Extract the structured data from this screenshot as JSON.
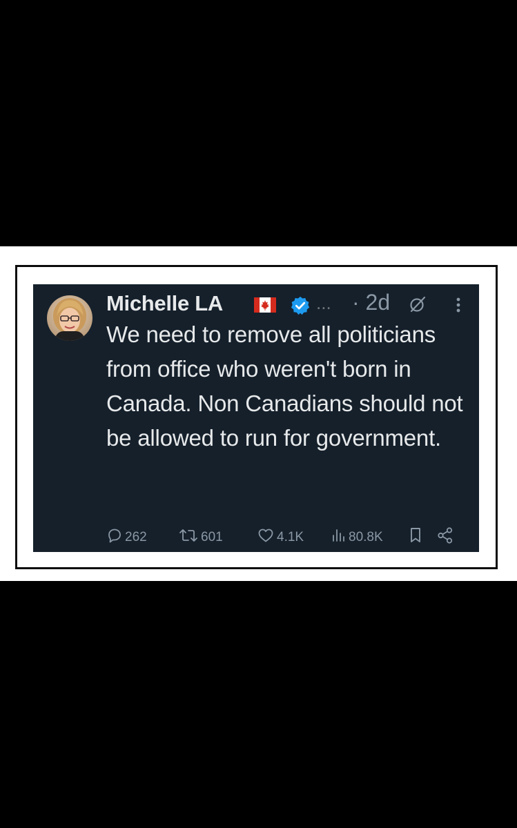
{
  "tweet": {
    "author_name": "Michelle LA",
    "more_indicator": "...",
    "time": "· 2d",
    "text": "We need to remove all politicians from office who weren't born in Canada. Non Canadians should not be allowed to run for government."
  },
  "icons": {
    "flag": "canada-flag-icon",
    "verified": "verified-badge-icon",
    "grok": "grok-icon",
    "more": "more-options-icon",
    "reply": "reply-icon",
    "retweet": "retweet-icon",
    "like": "like-icon",
    "views": "views-icon",
    "bookmark": "bookmark-icon",
    "share": "share-icon"
  },
  "metrics": {
    "replies": "262",
    "retweets": "601",
    "likes": "4.1K",
    "views": "80.8K"
  },
  "colors": {
    "background": "#000000",
    "card_background": "#15202b",
    "primary_text": "#e7e9ea",
    "secondary_text": "#8b98a5",
    "verified_blue": "#1d9bf0",
    "flag_red": "#d52b1e"
  }
}
